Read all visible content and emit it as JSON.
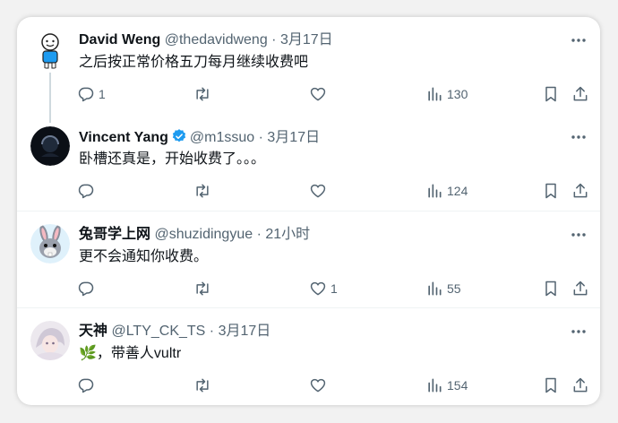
{
  "colors": {
    "accent": "#1d9bf0",
    "text": "#0f1419",
    "muted": "#536471",
    "divider": "#eff3f4"
  },
  "tweets": [
    {
      "name": "David Weng",
      "handle": "@thedavidweng",
      "dot": "·",
      "time": "3月17日",
      "text": "之后按正常价格五刀每月继续收费吧",
      "replies": "1",
      "retweets": "",
      "likes": "",
      "views": "130",
      "avatar_icon": "cartoon-person-avatar"
    },
    {
      "name": "Vincent Yang",
      "handle": "@m1ssuo",
      "dot": "·",
      "time": "3月17日",
      "text": "卧槽还真是，开始收费了。。。",
      "replies": "",
      "retweets": "",
      "likes": "",
      "views": "124",
      "verified": true,
      "avatar_icon": "dark-circle-avatar"
    },
    {
      "name": "兔哥学上网",
      "handle": "@shuzidingyue",
      "dot": "·",
      "time": "21小时",
      "text": "更不会通知你收费。",
      "replies": "",
      "retweets": "",
      "likes": "1",
      "views": "55",
      "avatar_icon": "rabbit-avatar"
    },
    {
      "name": "天神",
      "handle": "@LTY_CK_TS",
      "dot": "·",
      "time": "3月17日",
      "text": "，带善人vultr",
      "text_emoji": "🌿",
      "replies": "",
      "retweets": "",
      "likes": "",
      "views": "154",
      "avatar_icon": "anime-girl-avatar"
    }
  ]
}
